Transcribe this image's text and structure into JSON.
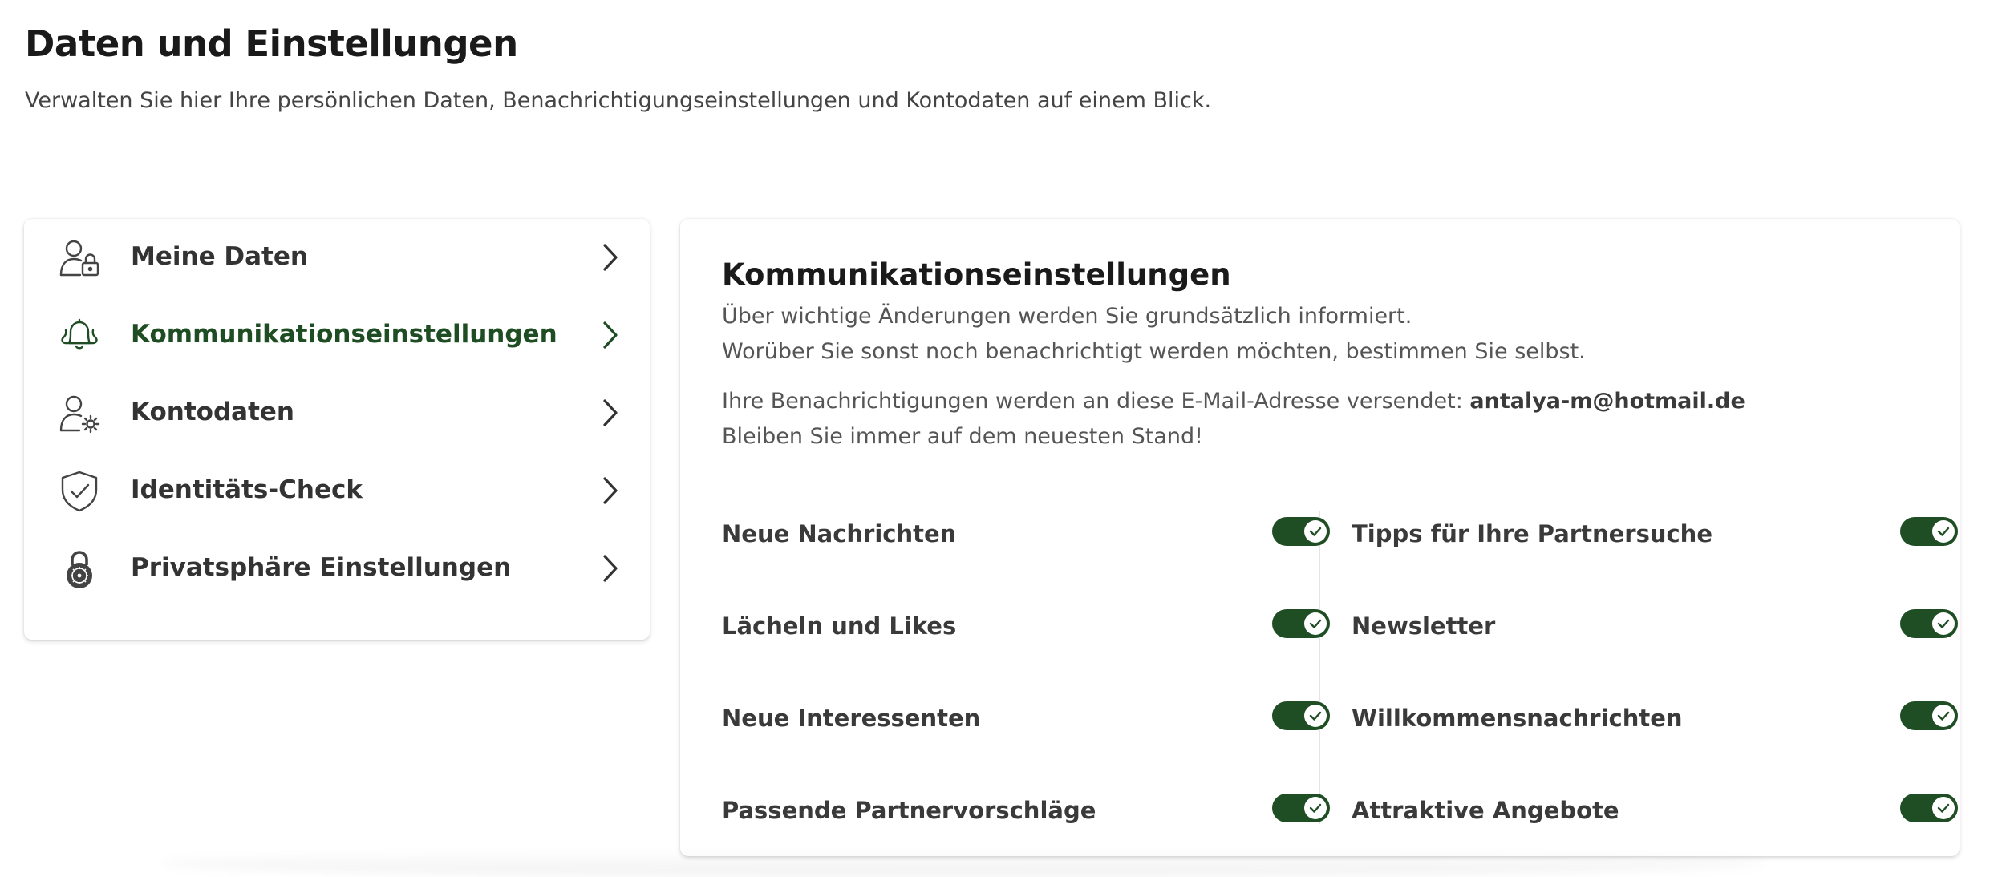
{
  "page": {
    "title": "Daten und Einstellungen",
    "subtitle": "Verwalten Sie hier Ihre persönlichen Daten, Benachrichtigungseinstellungen und Kontodaten auf einem Blick."
  },
  "nav": {
    "accent_color": "#1e4d23",
    "items": [
      {
        "label": "Meine Daten",
        "icon": "user-lock-icon",
        "active": false
      },
      {
        "label": "Kommunikationseinstellungen",
        "icon": "bell-icon",
        "active": true
      },
      {
        "label": "Kontodaten",
        "icon": "user-gear-icon",
        "active": false
      },
      {
        "label": "Identitäts-Check",
        "icon": "shield-check-icon",
        "active": false
      },
      {
        "label": "Privatsphäre Einstellungen",
        "icon": "padlock-icon",
        "active": false
      }
    ]
  },
  "settings": {
    "title": "Kommunikationseinstellungen",
    "info_line_1": "Über wichtige Änderungen werden Sie grundsätzlich informiert.",
    "info_line_2": "Worüber Sie sonst noch benachrichtigt werden möchten, bestimmen Sie selbst.",
    "email_prefix": "Ihre Benachrichtigungen werden an diese E-Mail-Adresse versendet: ",
    "email": "antalya-m@hotmail.de",
    "info_line_4": "Bleiben Sie immer auf dem neuesten Stand!",
    "toggle_color": "#1f4d24",
    "left_toggles": [
      {
        "label": "Neue Nachrichten",
        "on": true
      },
      {
        "label": "Lächeln und Likes",
        "on": true
      },
      {
        "label": "Neue Interessenten",
        "on": true
      },
      {
        "label": "Passende Partnervorschläge",
        "on": true
      }
    ],
    "right_toggles": [
      {
        "label": "Tipps für Ihre Partnersuche",
        "on": true
      },
      {
        "label": "Newsletter",
        "on": true
      },
      {
        "label": "Willkommensnachrichten",
        "on": true
      },
      {
        "label": "Attraktive Angebote",
        "on": true
      }
    ]
  }
}
